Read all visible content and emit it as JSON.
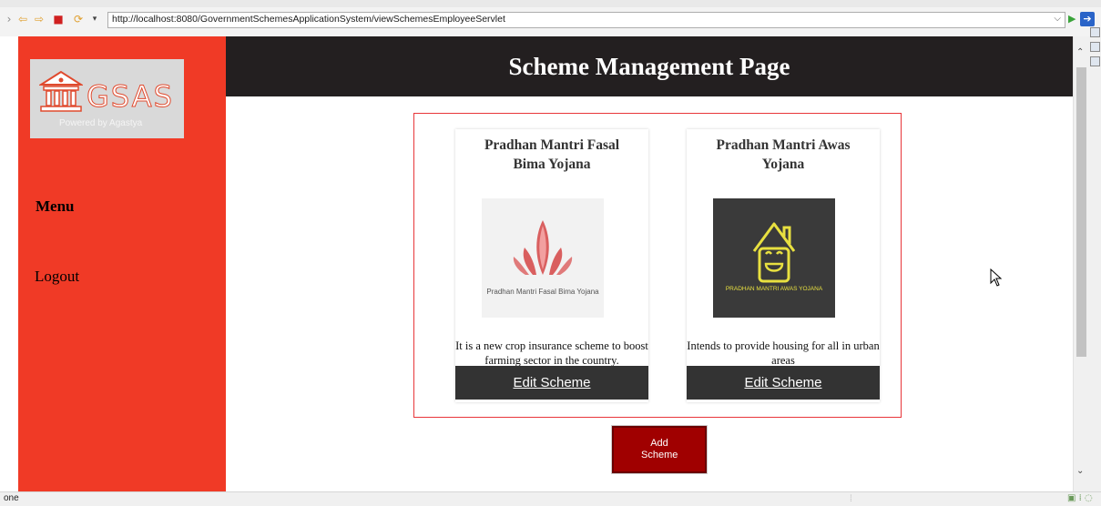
{
  "browser": {
    "url": "http://localhost:8080/GovernmentSchemesApplicationSystem/viewSchemesEmployeeServlet",
    "status": "one"
  },
  "sidebar": {
    "logo_text": "GSAS",
    "logo_subtitle": "Powered by Agastya",
    "menu_heading": "Menu",
    "logout_label": "Logout"
  },
  "header": {
    "title": "Scheme Management Page"
  },
  "schemes": [
    {
      "title": "Pradhan Mantri Fasal Bima Yojana",
      "image_caption": "Pradhan Mantri Fasal Bima Yojana",
      "description": "It is a new crop insurance scheme to boost farming sector in the country.",
      "button_label": "Edit Scheme"
    },
    {
      "title": "Pradhan Mantri Awas Yojana",
      "image_caption": "PRADHAN MANTRI AWAS YOJANA",
      "description": "Intends to provide housing for all in urban areas",
      "button_label": "Edit Scheme"
    }
  ],
  "actions": {
    "add_scheme_label": "Add Scheme"
  },
  "colors": {
    "sidebar": "#f03a26",
    "header": "#231f20",
    "border": "#e8363a",
    "edit_button": "#333333",
    "add_button": "#a00000"
  }
}
